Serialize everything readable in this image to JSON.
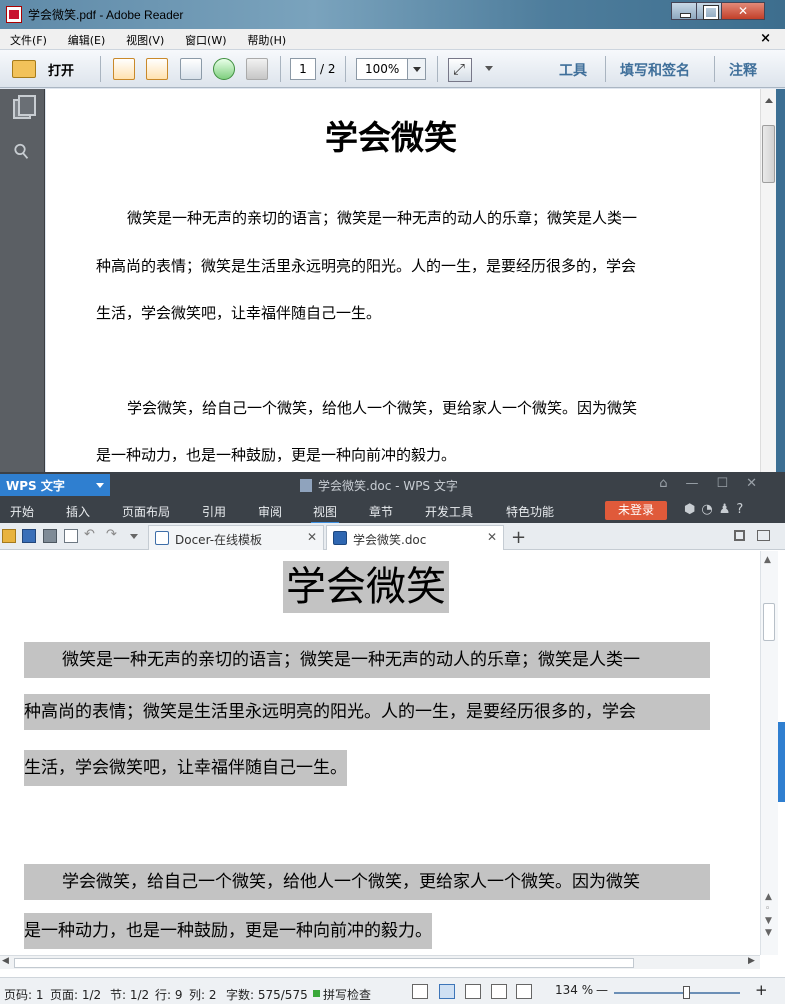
{
  "reader": {
    "title": "学会微笑.pdf - Adobe Reader",
    "menu": [
      "文件(F)",
      "编辑(E)",
      "视图(V)",
      "窗口(W)",
      "帮助(H)"
    ],
    "close_doc": "×",
    "toolbar": {
      "open_label": "打开",
      "page_current": "1",
      "page_total": "/ 2",
      "zoom": "100%",
      "tools_label": "工具",
      "sign_label": "填写和签名",
      "comment_label": "注释"
    },
    "document": {
      "title": "学会微笑",
      "lines": [
        "微笑是一种无声的亲切的语言；微笑是一种无声的动人的乐章；微笑是人类一",
        "种高尚的表情；微笑是生活里永远明亮的阳光。人的一生，是要经历很多的，学会",
        "生活，学会微笑吧，让幸福伴随自己一生。",
        "学会微笑，给自己一个微笑，给他人一个微笑，更给家人一个微笑。因为微笑",
        "是一种动力，也是一种鼓励，更是一种向前冲的毅力。"
      ]
    }
  },
  "wps": {
    "app_label": "WPS 文字",
    "window_title": "学会微笑.doc - WPS 文字",
    "ribbon_tabs": [
      "开始",
      "插入",
      "页面布局",
      "引用",
      "审阅",
      "视图",
      "章节",
      "开发工具",
      "特色功能"
    ],
    "login_label": "未登录",
    "doc_tabs": [
      "Docer-在线模板",
      "学会微笑.doc"
    ],
    "document": {
      "title": "学会微笑",
      "lines": [
        "微笑是一种无声的亲切的语言；微笑是一种无声的动人的乐章；微笑是人类一",
        "种高尚的表情；微笑是生活里永远明亮的阳光。人的一生，是要经历很多的，学会",
        "生活，学会微笑吧，让幸福伴随自己一生。",
        "学会微笑，给自己一个微笑，给他人一个微笑，更给家人一个微笑。因为微笑",
        "是一种动力，也是一种鼓励，更是一种向前冲的毅力。"
      ]
    },
    "status": {
      "page_num": "页码: 1",
      "pages": "页面: 1/2",
      "section": "节: 1/2",
      "row": "行: 9",
      "col": "列: 2",
      "words": "字数: 575/575",
      "spell": "拼写检查",
      "zoom": "134 %",
      "zoom_minus": "—",
      "zoom_plus": "+"
    }
  }
}
